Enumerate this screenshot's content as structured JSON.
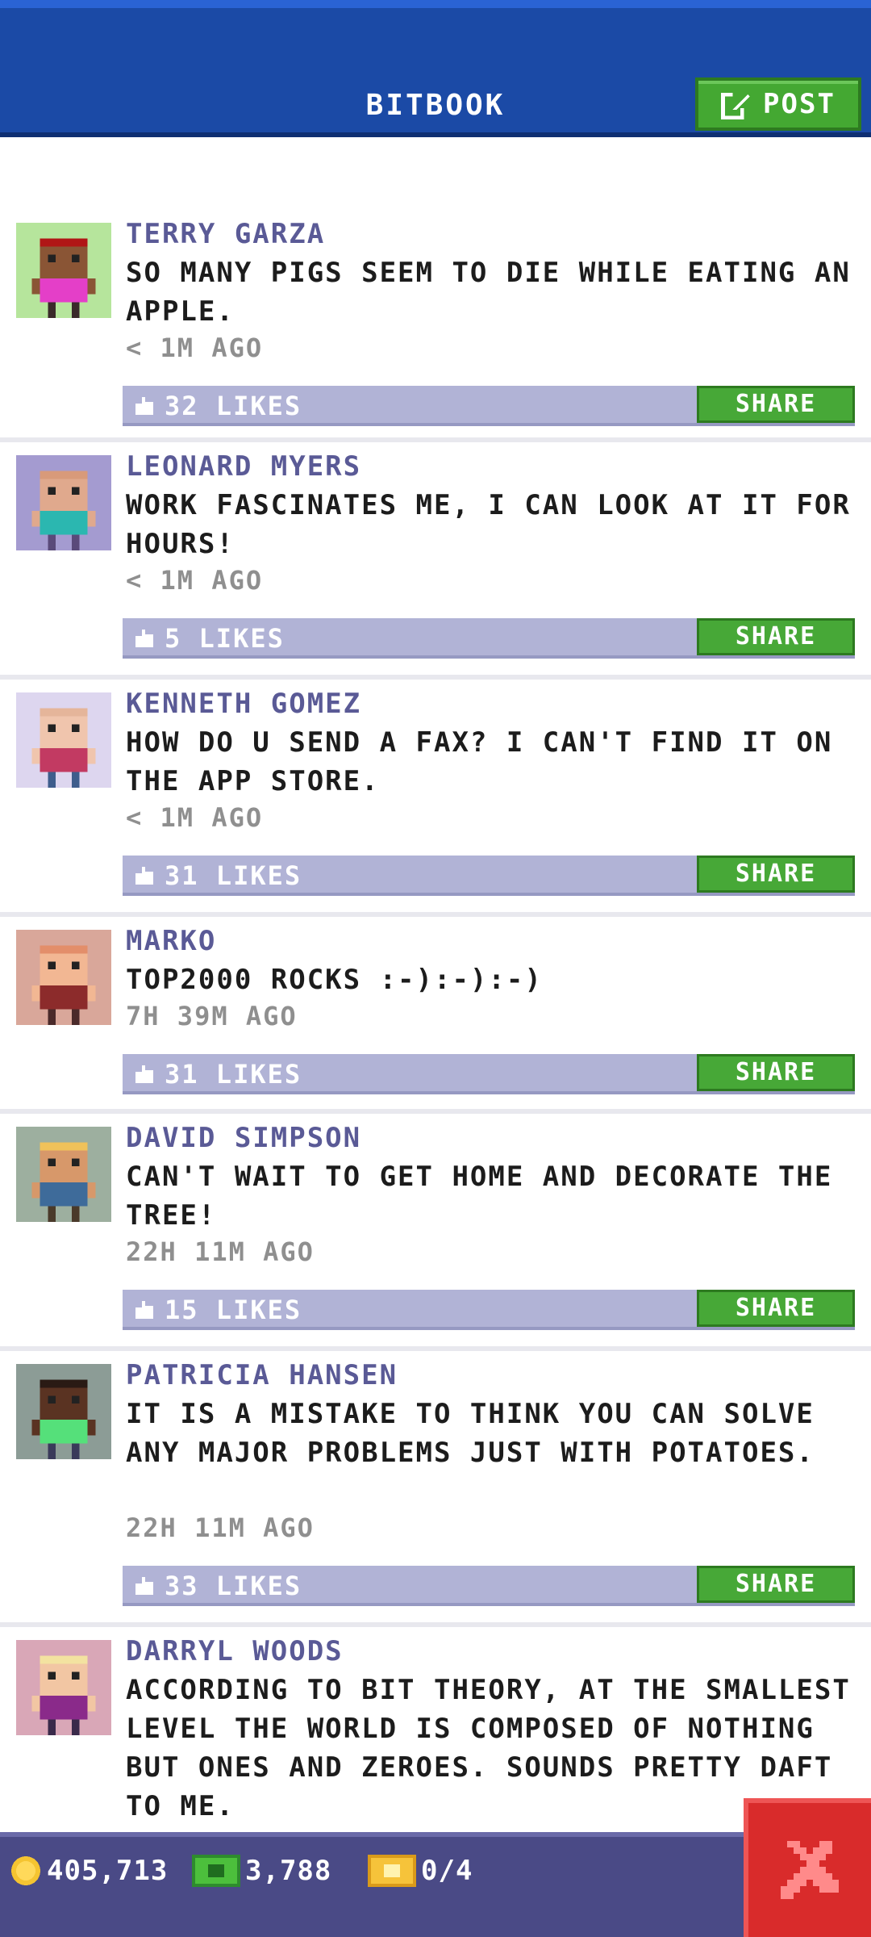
{
  "header": {
    "title": "BITBOOK",
    "post_label": "POST",
    "post_icon": "compose-icon"
  },
  "posts": [
    {
      "name": "TERRY GARZA",
      "message": "SO MANY PIGS SEEM TO DIE WHILE EATING AN APPLE.",
      "time": "< 1M AGO",
      "likes": "32 LIKES",
      "share": "SHARE",
      "avatar_bg": "#b6e59c",
      "skin": "#8a5535",
      "hair": "#b01616",
      "shirt": "#e43fc8",
      "pants": "#3a2a2a"
    },
    {
      "name": "LEONARD MYERS",
      "message": "WORK FASCINATES ME, I CAN LOOK AT IT FOR HOURS!",
      "time": "< 1M AGO",
      "likes": "5 LIKES",
      "share": "SHARE",
      "avatar_bg": "#a49bd0",
      "skin": "#e0a98d",
      "hair": "#d89a7a",
      "shirt": "#2bb7b0",
      "pants": "#5a4a7a"
    },
    {
      "name": "KENNETH GOMEZ",
      "message": "HOW DO U SEND A FAX? I CAN'T FIND IT ON THE APP STORE.",
      "time": "< 1M AGO",
      "likes": "31 LIKES",
      "share": "SHARE",
      "avatar_bg": "#ddd6ef",
      "skin": "#f0c5ad",
      "hair": "#e5b59a",
      "shirt": "#c23a62",
      "pants": "#3e5d8c"
    },
    {
      "name": "MARKO",
      "message": "TOP2000 ROCKS :-):-):-)",
      "time": "7H 39M AGO",
      "likes": "31 LIKES",
      "share": "SHARE",
      "avatar_bg": "#d9a79a",
      "skin": "#f2b793",
      "hair": "#e38e6a",
      "shirt": "#8c2b2b",
      "pants": "#4a2a2a"
    },
    {
      "name": "DAVID SIMPSON",
      "message": "CAN'T WAIT TO GET HOME AND DECORATE THE TREE!",
      "time": "22H 11M AGO",
      "likes": "15 LIKES",
      "share": "SHARE",
      "avatar_bg": "#9daf9f",
      "skin": "#d7986a",
      "hair": "#f0c25a",
      "shirt": "#3e6b9a",
      "pants": "#4a3a2a"
    },
    {
      "name": "PATRICIA HANSEN",
      "message": "IT IS A MISTAKE TO THINK YOU CAN SOLVE ANY MAJOR PROBLEMS JUST WITH POTATOES.",
      "time": "22H 11M AGO",
      "likes": "33 LIKES",
      "share": "SHARE",
      "avatar_bg": "#8c9c96",
      "skin": "#5a3322",
      "hair": "#2a1a14",
      "shirt": "#55e07a",
      "pants": "#3a3a5a"
    },
    {
      "name": "DARRYL WOODS",
      "message": "ACCORDING TO BIT THEORY, AT THE SMALLEST LEVEL THE WORLD IS COMPOSED OF NOTHING BUT ONES AND ZEROES. SOUNDS PRETTY DAFT TO ME.",
      "time": "",
      "likes": "",
      "share": "",
      "avatar_bg": "#d9a7b7",
      "skin": "#f2c6a3",
      "hair": "#f3e2a0",
      "shirt": "#8a2a8a",
      "pants": "#3a2a4a"
    }
  ],
  "footer": {
    "coins": "405,713",
    "cash": "3,788",
    "tickets": "0/4",
    "coin_icon": "coin-icon",
    "cash_icon": "bux-icon",
    "ticket_icon": "ticket-icon",
    "close_icon": "close-icon"
  },
  "colors": {
    "header": "#1b4aa6",
    "accent_green": "#44a832",
    "likes_bar": "#b1b3d6",
    "name_text": "#5a5a96",
    "close_red": "#d92b2b",
    "footer": "#4a4a86"
  }
}
